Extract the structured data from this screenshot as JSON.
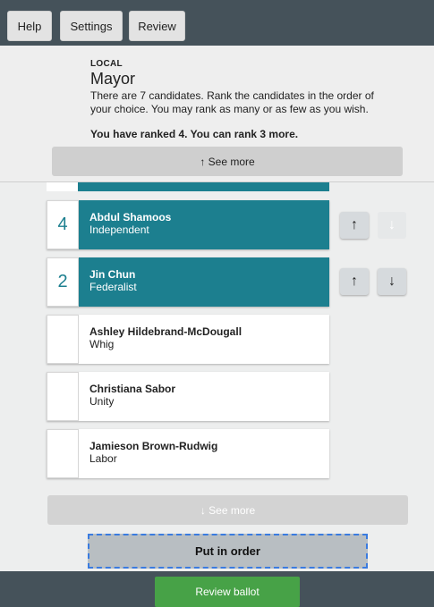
{
  "toolbar": {
    "help_label": "Help",
    "settings_label": "Settings",
    "review_label": "Review"
  },
  "contest": {
    "section": "LOCAL",
    "title": "Mayor",
    "description": "There are 7 candidates. Rank the candidates in the order of your choice. You may rank as many or as few as you wish.",
    "ranked_message": "You have ranked 4. You can rank 3 more."
  },
  "see_more_top": "↑ See more",
  "see_more_bottom": "↓ See more",
  "candidates": [
    {
      "rank": "4",
      "name": "Abdul Shamoos",
      "party": "Independent",
      "ranked": true,
      "up_enabled": true,
      "down_enabled": false
    },
    {
      "rank": "2",
      "name": "Jin Chun",
      "party": "Federalist",
      "ranked": true,
      "up_enabled": true,
      "down_enabled": true
    },
    {
      "rank": "",
      "name": "Ashley Hildebrand-McDougall",
      "party": "Whig",
      "ranked": false
    },
    {
      "rank": "",
      "name": "Christiana Sabor",
      "party": "Unity",
      "ranked": false
    },
    {
      "rank": "",
      "name": "Jamieson Brown-Rudwig",
      "party": "Labor",
      "ranked": false
    }
  ],
  "arrow_glyphs": {
    "up": "↑",
    "down": "↓"
  },
  "put_in_order_label": "Put in order",
  "review_ballot_label": "Review ballot",
  "colors": {
    "topbar": "#45525a",
    "ranked_card": "#1c7f8f",
    "review_ballot": "#47a247",
    "focus_outline": "#3a7be0"
  }
}
